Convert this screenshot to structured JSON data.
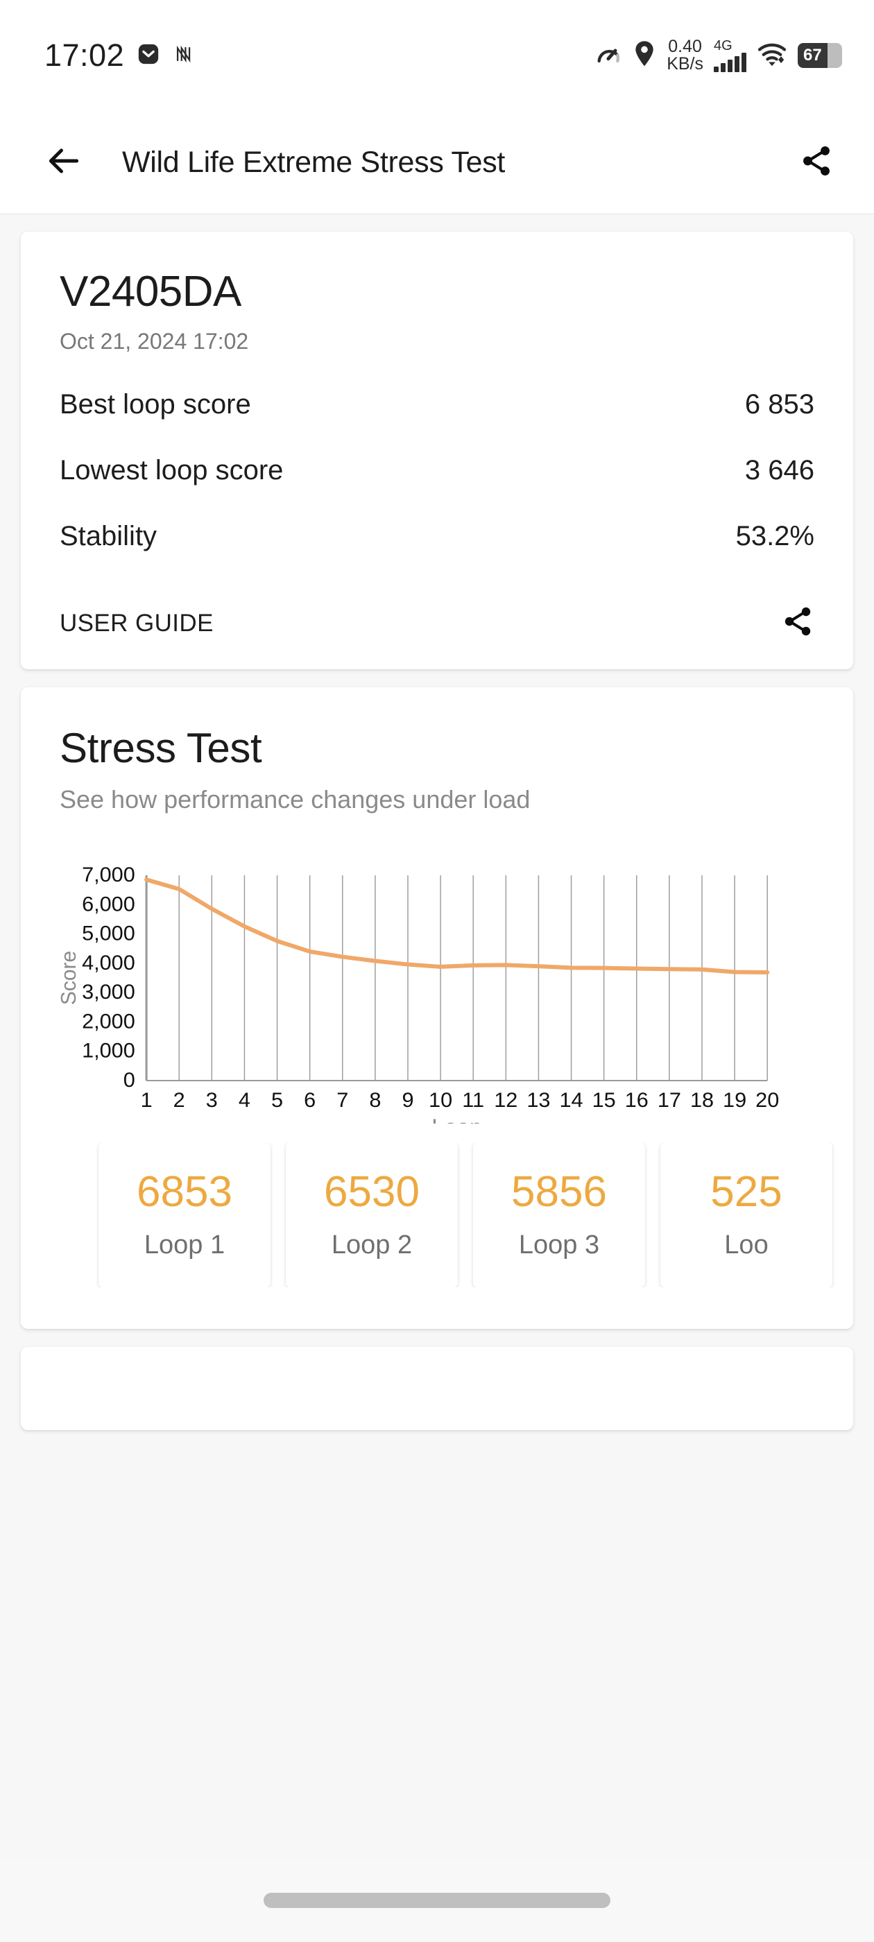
{
  "statusbar": {
    "time": "17:02",
    "net_speed_value": "0.40",
    "net_speed_unit": "KB/s",
    "network_generation": "4G",
    "battery_percent": "67",
    "icons": [
      "mail-icon",
      "nfc-icon",
      "speedometer-icon",
      "location-pin-icon",
      "signal-bars-icon",
      "wifi-icon",
      "battery-icon"
    ]
  },
  "appbar": {
    "back_label": "back-arrow",
    "title": "Wild Life Extreme Stress Test",
    "share_label": "share"
  },
  "summary": {
    "device_name": "V2405DA",
    "timestamp": "Oct 21, 2024 17:02",
    "stats": [
      {
        "label": "Best loop score",
        "value": "6 853"
      },
      {
        "label": "Lowest loop score",
        "value": "3 646"
      },
      {
        "label": "Stability",
        "value": "53.2%"
      }
    ],
    "user_guide_label": "USER GUIDE"
  },
  "stress": {
    "title": "Stress Test",
    "subtitle": "See how performance changes under load",
    "loop_cards": [
      {
        "score": "6853",
        "label": "Loop 1"
      },
      {
        "score": "6530",
        "label": "Loop 2"
      },
      {
        "score": "5856",
        "label": "Loop 3"
      },
      {
        "score": "525",
        "label": "Loo"
      }
    ]
  },
  "colors": {
    "accent_orange": "#eda940",
    "line_orange": "#f0a868",
    "grid_gray": "#a8a8a8",
    "text_dark": "#1c1c1c",
    "text_muted": "#8a8a8a",
    "page_bg": "#f7f7f7"
  },
  "chart_data": {
    "type": "line",
    "title": "",
    "xlabel": "Loop",
    "ylabel": "Score",
    "x": [
      1,
      2,
      3,
      4,
      5,
      6,
      7,
      8,
      9,
      10,
      11,
      12,
      13,
      14,
      15,
      16,
      17,
      18,
      19,
      20
    ],
    "categories": [
      "1",
      "2",
      "3",
      "4",
      "5",
      "6",
      "7",
      "8",
      "9",
      "10",
      "11",
      "12",
      "13",
      "14",
      "15",
      "16",
      "17",
      "18",
      "19",
      "20"
    ],
    "values": [
      6853,
      6530,
      5856,
      5255,
      4760,
      4400,
      4220,
      4080,
      3960,
      3880,
      3930,
      3940,
      3900,
      3845,
      3840,
      3820,
      3800,
      3790,
      3700,
      3690
    ],
    "ylim": [
      0,
      7000
    ],
    "yticks": [
      0,
      1000,
      2000,
      3000,
      4000,
      5000,
      6000,
      7000
    ],
    "ytick_labels": [
      "0",
      "1,000",
      "2,000",
      "3,000",
      "4,000",
      "5,000",
      "6,000",
      "7,000"
    ],
    "grid": "vertical",
    "legend": "none",
    "series": [
      {
        "name": "Score",
        "color": "#f0a868",
        "values": [
          6853,
          6530,
          5856,
          5255,
          4760,
          4400,
          4220,
          4080,
          3960,
          3880,
          3930,
          3940,
          3900,
          3845,
          3840,
          3820,
          3800,
          3790,
          3700,
          3690
        ]
      }
    ]
  }
}
